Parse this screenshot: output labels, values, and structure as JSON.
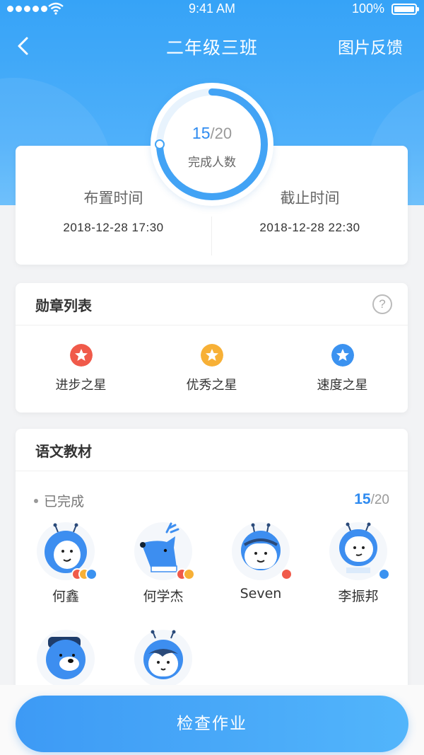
{
  "status_bar": {
    "time": "9:41 AM",
    "battery": "100%"
  },
  "nav": {
    "title": "二年级三班",
    "action_label": "图片反馈"
  },
  "progress": {
    "done": "15",
    "total": "/20",
    "label": "完成人数",
    "fraction": 0.75
  },
  "assign_time": {
    "label": "布置时间",
    "value": "2018-12-28 17:30"
  },
  "due_time": {
    "label": "截止时间",
    "value": "2018-12-28 22:30"
  },
  "medals": {
    "title": "勋章列表",
    "help_icon": "question-circle-icon",
    "help_glyph": "?",
    "items": [
      {
        "label": "进步之星",
        "color": "#f05a4a",
        "icon": "star-icon"
      },
      {
        "label": "优秀之星",
        "color": "#f7b036",
        "icon": "star-icon"
      },
      {
        "label": "速度之星",
        "color": "#3b92f0",
        "icon": "star-icon"
      }
    ]
  },
  "textbook": {
    "title": "语文教材",
    "completed_label": "已完成",
    "completed_done": "15",
    "completed_total": "/20",
    "students": [
      {
        "name": "何鑫",
        "avatar": "bug-avatar",
        "badges": [
          "#f05a4a",
          "#f7b036",
          "#3b92f0"
        ]
      },
      {
        "name": "何学杰",
        "avatar": "deer-avatar",
        "badges": [
          "#f05a4a",
          "#f7b036"
        ]
      },
      {
        "name": "Seven",
        "avatar": "kid-avatar",
        "badges": [
          "#f05a4a"
        ]
      },
      {
        "name": "李振邦",
        "avatar": "robot-avatar",
        "badges": [
          "#3b92f0"
        ]
      },
      {
        "name": "",
        "avatar": "bear-avatar",
        "badges": []
      },
      {
        "name": "",
        "avatar": "girl-avatar",
        "badges": []
      }
    ]
  },
  "primary_button": {
    "label": "检查作业"
  },
  "colors": {
    "primary": "#36a3f7",
    "accent": "#2f8bf0"
  }
}
